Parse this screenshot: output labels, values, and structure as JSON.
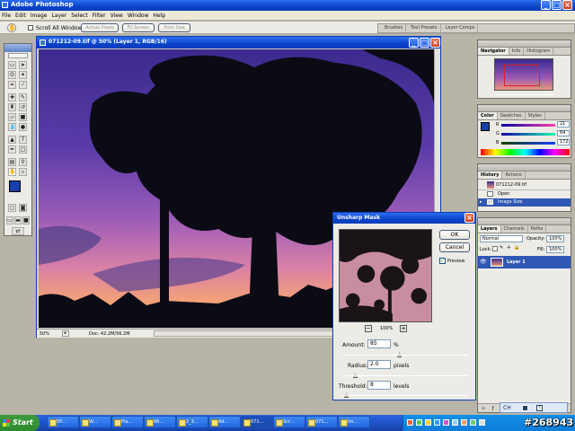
{
  "app": {
    "title": "Adobe Photoshop"
  },
  "menu": [
    "File",
    "Edit",
    "Image",
    "Layer",
    "Select",
    "Filter",
    "View",
    "Window",
    "Help"
  ],
  "options_bar": {
    "scroll_all_windows": "Scroll All Windows",
    "actual_pixels": "Actual Pixels",
    "fit_screen": "Fit Screen",
    "print_size": "Print Size",
    "well_tabs": [
      "Brushes",
      "Tool Presets",
      "Layer Comps"
    ]
  },
  "document": {
    "title": "071212-09.tif @ 50% (Layer 1, RGB/16)",
    "zoom": "50%",
    "doc_size": "Doc: 42.2M/56.2M"
  },
  "navigator": {
    "tabs": [
      "Navigator",
      "Info",
      "Histogram"
    ]
  },
  "color_panel": {
    "tabs": [
      "Color",
      "Swatches",
      "Styles"
    ],
    "channels": [
      {
        "label": "R",
        "value": "21"
      },
      {
        "label": "G",
        "value": "64"
      },
      {
        "label": "B",
        "value": "172"
      }
    ],
    "foreground": "#1540ac"
  },
  "history": {
    "tabs": [
      "History",
      "Actions"
    ],
    "snapshot": "071212-09.tif",
    "items": [
      "Open",
      "Image Size"
    ]
  },
  "layers": {
    "tabs": [
      "Layers",
      "Channels",
      "Paths"
    ],
    "blend_mode": "Normal",
    "opacity_label": "Opacity:",
    "opacity": "100%",
    "lock_label": "Lock:",
    "fill_label": "Fill:",
    "fill": "100%",
    "layer_name": "Layer 1"
  },
  "dialog": {
    "title": "Unsharp Mask",
    "ok": "OK",
    "cancel": "Cancel",
    "preview": "Preview",
    "preview_zoom": "100%",
    "amount_label": "Amount:",
    "amount": "85",
    "amount_unit": "%",
    "radius_label": "Radius:",
    "radius": "2.0",
    "radius_unit": "pixels",
    "threshold_label": "Threshold:",
    "threshold": "8",
    "threshold_unit": "levels"
  },
  "taskbar": {
    "start": "Start",
    "items": [
      "EP...",
      "W...",
      "Pla...",
      "Wi...",
      "2_3...",
      "Ad...",
      "071...",
      "Scr...",
      "071...",
      "Im..."
    ],
    "language": "CH",
    "watermark": "#268943"
  }
}
